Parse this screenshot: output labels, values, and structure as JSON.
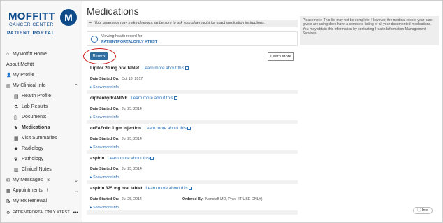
{
  "brand": {
    "wordmark": "MOFFITT",
    "subtitle": "CANCER CENTER",
    "portal": "PATIENT PORTAL",
    "mark": "M",
    "color": "#0d4a8a"
  },
  "sidebar": {
    "items": [
      {
        "label": "MyMoffitt Home",
        "icon": "home-icon",
        "glyph": "⌂"
      },
      {
        "label": "About Moffitt",
        "icon": "",
        "glyph": ""
      },
      {
        "label": "My Profile",
        "icon": "person-icon",
        "glyph": "👤"
      },
      {
        "label": "My Clinical Info",
        "icon": "clipboard-icon",
        "glyph": "▤",
        "chevron": "⌃"
      }
    ],
    "subitems": [
      {
        "label": "Health Profile",
        "icon": "clipboard-icon",
        "glyph": "▤"
      },
      {
        "label": "Lab Results",
        "icon": "flask-icon",
        "glyph": "⚗"
      },
      {
        "label": "Documents",
        "icon": "document-icon",
        "glyph": "▯"
      },
      {
        "label": "Medications",
        "icon": "pill-icon",
        "glyph": "✎",
        "active": true
      },
      {
        "label": "Visit Summaries",
        "icon": "calendar-icon",
        "glyph": "▦"
      },
      {
        "label": "Radiology",
        "icon": "radiology-icon",
        "glyph": "✹"
      },
      {
        "label": "Pathology",
        "icon": "pathology-icon",
        "glyph": "❦"
      },
      {
        "label": "Clinical Notes",
        "icon": "notes-icon",
        "glyph": "▥"
      }
    ],
    "lower": [
      {
        "label": "My Messages",
        "icon": "mail-icon",
        "glyph": "✉",
        "badge": "!s",
        "chevron": "⌄"
      },
      {
        "label": "Appointments",
        "icon": "calendar-icon",
        "glyph": "▦",
        "badge": "!",
        "chevron": "⌄"
      },
      {
        "label": "My Rx Renewal",
        "icon": "rx-icon",
        "glyph": "℞"
      }
    ],
    "user": "PATIENTPORTALONLY XTEST",
    "user_menu": "•••"
  },
  "main": {
    "title": "Medications",
    "alert": "Your pharmacy may make changes, as be sure to ask your pharmacist for exact medication instructions.",
    "viewing_label": "Viewing health record for",
    "viewing_name": "PATIENTPORTALONLY XTEST",
    "renew_label": "Renew",
    "learn_more_label": "Learn More",
    "started_label": "Date Started On:",
    "show_more": "Show more info",
    "learn_link": "Learn more about this",
    "ordered_label": "Ordered By:",
    "medications": [
      {
        "name": "Lipitor 20 mg oral tablet",
        "date": "Oct 18, 2017"
      },
      {
        "name": "diphenhydrAMINE",
        "date": "Jul 25, 2014"
      },
      {
        "name": "ceFAZolin 1 gm injection",
        "date": "Jul 25, 2014"
      },
      {
        "name": "aspirin",
        "date": "Jul 25, 2014"
      },
      {
        "name": "aspirin 325 mg oral tablet",
        "date": "Jul 25, 2014",
        "ordered_by": "Nonstaff MD, Phys (IT USE ONLY)"
      }
    ]
  },
  "note": "Please note: This list may not be complete. However, the medical record your care givers are using does have a complete listing of all your documented medications. You may obtain this information by contacting Health Information Management Services.",
  "info_label": "Info",
  "accent": "#2c6fb5",
  "highlight_color": "#d01c1c"
}
